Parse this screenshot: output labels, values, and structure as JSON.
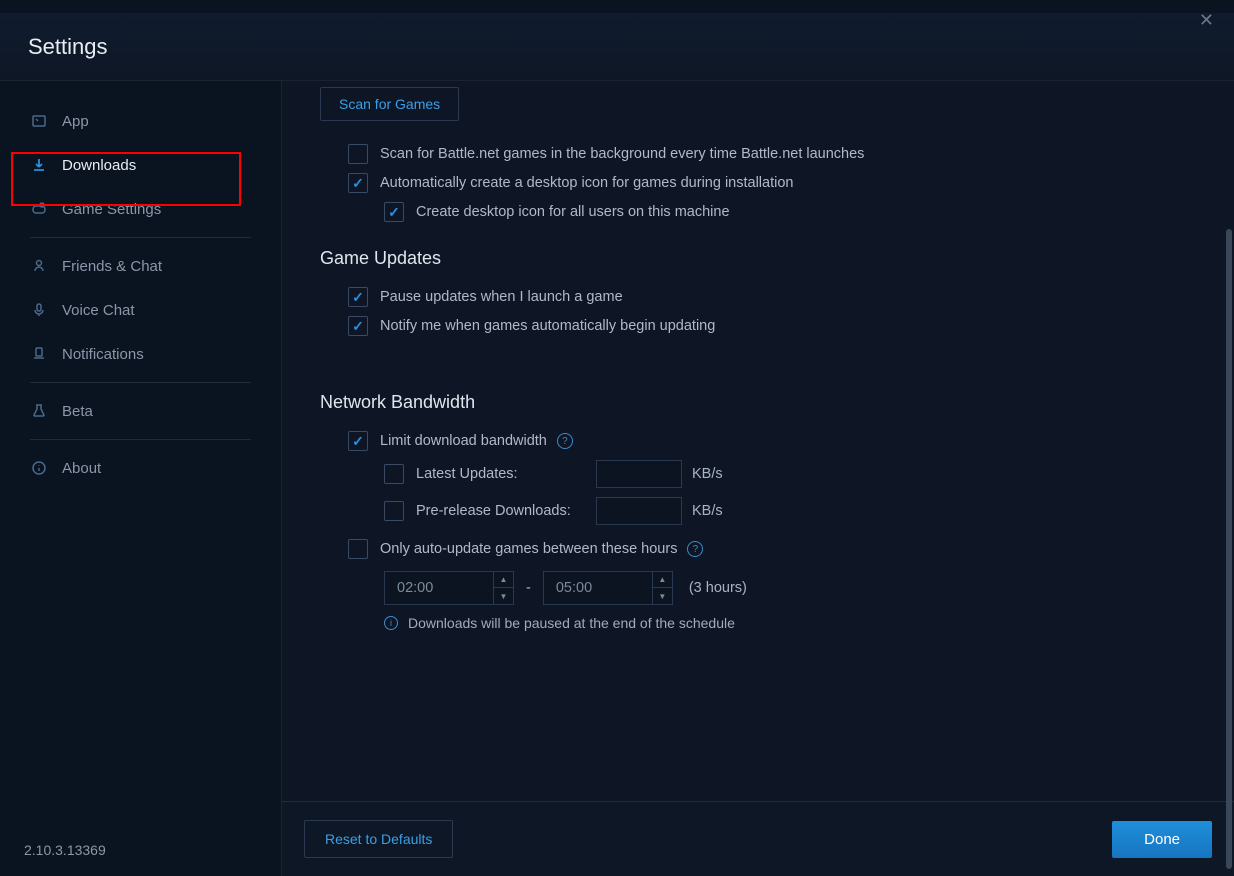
{
  "header": {
    "title": "Settings"
  },
  "sidebar": {
    "items": [
      {
        "label": "App"
      },
      {
        "label": "Downloads"
      },
      {
        "label": "Game Settings"
      },
      {
        "label": "Friends & Chat"
      },
      {
        "label": "Voice Chat"
      },
      {
        "label": "Notifications"
      },
      {
        "label": "Beta"
      },
      {
        "label": "About"
      }
    ],
    "version": "2.10.3.13369"
  },
  "content": {
    "scanButton": "Scan for Games",
    "scanBackground": "Scan for Battle.net games in the background every time Battle.net launches",
    "autoDesktopIcon": "Automatically create a desktop icon for games during installation",
    "desktopIconAllUsers": "Create desktop icon for all users on this machine",
    "gameUpdatesTitle": "Game Updates",
    "pauseUpdates": "Pause updates when I launch a game",
    "notifyUpdates": "Notify me when games automatically begin updating",
    "networkBandwidthTitle": "Network Bandwidth",
    "limitBandwidth": "Limit download bandwidth",
    "latestUpdates": "Latest Updates:",
    "preRelease": "Pre-release Downloads:",
    "unit": "KB/s",
    "onlyAutoUpdate": "Only auto-update games between these hours",
    "timeFrom": "02:00",
    "timeTo": "05:00",
    "hoursNote": "(3 hours)",
    "scheduleInfo": "Downloads will be paused at the end of the schedule"
  },
  "footer": {
    "reset": "Reset to Defaults",
    "done": "Done"
  }
}
